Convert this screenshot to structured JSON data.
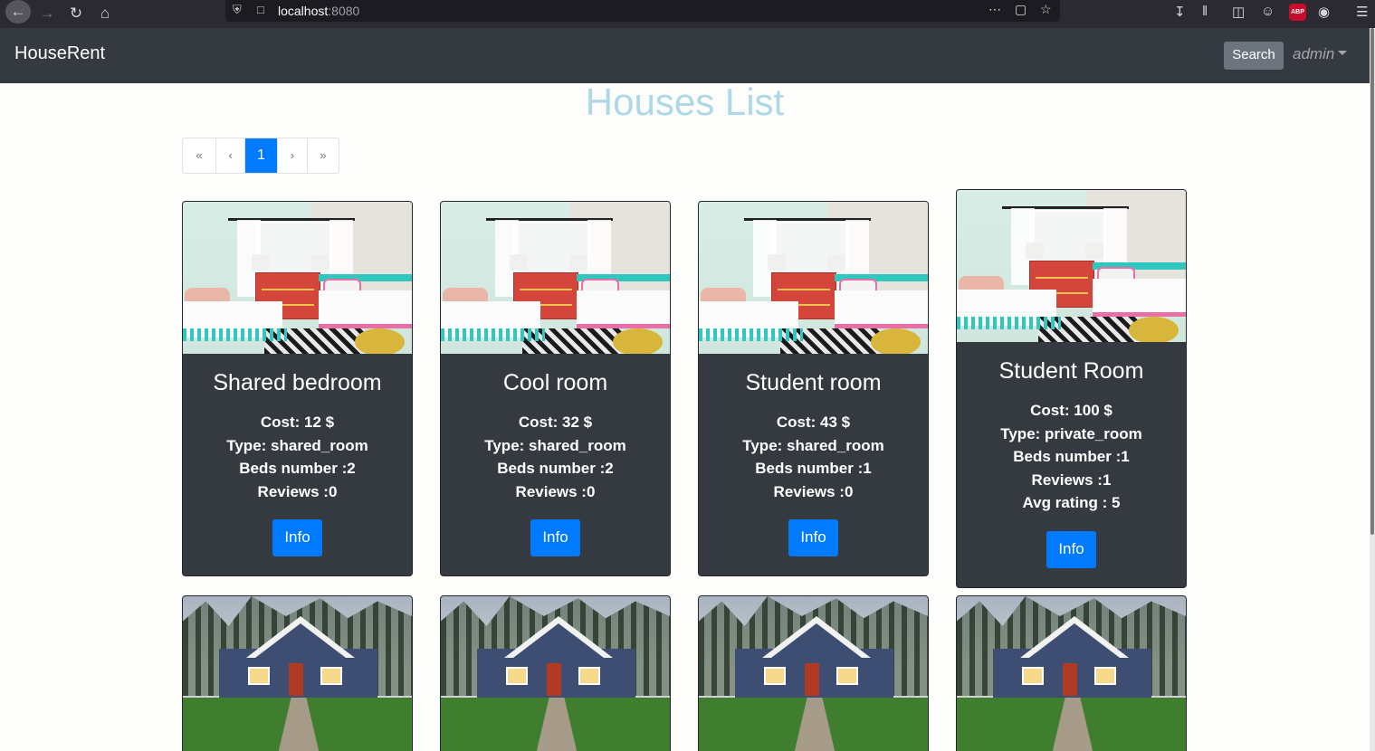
{
  "browser": {
    "url_host": "localhost",
    "url_port": ":8080"
  },
  "navbar": {
    "brand": "HouseRent",
    "search_label": "Search",
    "user": "admin"
  },
  "page": {
    "title": "Houses List"
  },
  "pagination": {
    "first": "«",
    "prev": "‹",
    "current": "1",
    "next": "›",
    "last": "»"
  },
  "houses": [
    {
      "title": "Shared bedroom",
      "cost": "Cost: 12 $",
      "type": "Type: shared_room",
      "beds": "Beds number :2",
      "reviews": "Reviews :0",
      "button": "Info"
    },
    {
      "title": "Cool room",
      "cost": "Cost: 32 $",
      "type": "Type: shared_room",
      "beds": "Beds number :2",
      "reviews": "Reviews :0",
      "button": "Info"
    },
    {
      "title": "Student room",
      "cost": "Cost: 43 $",
      "type": "Type: shared_room",
      "beds": "Beds number :1",
      "reviews": "Reviews :0",
      "button": "Info"
    },
    {
      "title": "Student Room",
      "cost": "Cost: 100 $",
      "type": "Type: private_room",
      "beds": "Beds number :1",
      "reviews": "Reviews :1",
      "rating": "Avg rating : 5",
      "button": "Info"
    }
  ],
  "colors": {
    "navbar_bg": "#343a40",
    "card_bg": "#343a40",
    "primary": "#007bff",
    "title": "#add8e6",
    "search_btn": "#6c757d"
  }
}
